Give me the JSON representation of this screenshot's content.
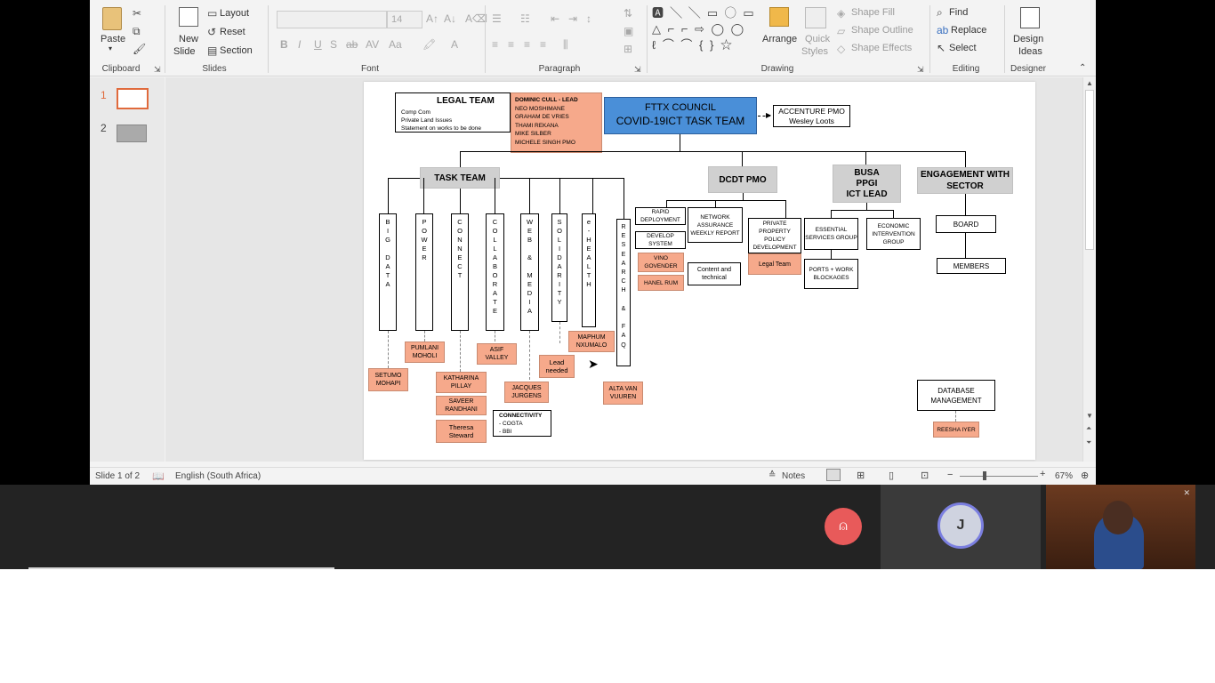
{
  "ribbon": {
    "clipboard": {
      "paste": "Paste",
      "label": "Clipboard"
    },
    "slides": {
      "new_slide": "New",
      "new_slide2": "Slide",
      "layout": "Layout",
      "reset": "Reset",
      "section": "Section",
      "label": "Slides"
    },
    "font": {
      "size": "14",
      "label": "Font"
    },
    "paragraph": {
      "label": "Paragraph"
    },
    "drawing": {
      "arrange": "Arrange",
      "quick_styles": "Quick",
      "quick_styles2": "Styles",
      "shape_fill": "Shape Fill",
      "shape_outline": "Shape Outline",
      "shape_effects": "Shape Effects",
      "label": "Drawing"
    },
    "editing": {
      "find": "Find",
      "replace": "Replace",
      "select": "Select",
      "label": "Editing"
    },
    "designer": {
      "design": "Design",
      "ideas": "Ideas",
      "label": "Designer"
    }
  },
  "thumbnails": [
    {
      "num": "1"
    },
    {
      "num": "2"
    }
  ],
  "slide": {
    "legal": {
      "title": "LEGAL TEAM",
      "items": [
        "Comp Com",
        "Private Land Issues",
        "Statement on works to be done"
      ]
    },
    "legal_members": [
      "DOMINIC CULL - LEAD",
      "NEO MOSHIMANE",
      "GRAHAM DE VRIES",
      "THAMI REKANA",
      "MIKE SILBER",
      "MICHELE SINGH PMO"
    ],
    "council": {
      "line1": "FTTX COUNCIL",
      "line2": "COVID-19ICT TASK TEAM"
    },
    "accenture": {
      "line1": "ACCENTURE PMO",
      "line2": "Wesley Loots"
    },
    "task_team": "TASK TEAM",
    "dcdt": "DCDT PMO",
    "busa": {
      "l1": "BUSA",
      "l2": "PPGI",
      "l3": "ICT LEAD"
    },
    "engagement": {
      "l1": "ENGAGEMENT WITH",
      "l2": "SECTOR"
    },
    "columns": [
      {
        "text": "B\nI\nG\n\nD\nA\nT\nA"
      },
      {
        "text": "P\nO\nW\nE\nR"
      },
      {
        "text": "C\nO\nN\nN\nE\nC\nT"
      },
      {
        "text": "C\nO\nL\nL\nA\nB\nO\nR\nA\nT\nE"
      },
      {
        "text": "W\nE\nB\n\n&\n\nM\nE\nD\nI\nA"
      },
      {
        "text": "S\nO\nL\nI\nD\nA\nR\nI\nT\nY"
      },
      {
        "text": "e\n-\nH\nE\nA\nL\nT\nH"
      },
      {
        "text": "R\nE\nS\nE\nA\nR\nC\nH\n\n&\n\nF\nA\nQ"
      }
    ],
    "people": {
      "setumo": "SETUMO MOHAPI",
      "pumlani": "PUMLANI MOHOLI",
      "katharina": "KATHARINA PILLAY",
      "saveer": "SAVEER RANDHANI",
      "theresa": "Theresa Steward",
      "asif": "ASIF VALLEY",
      "jacques": "JACQUES JURGENS",
      "lead_needed": "Lead needed",
      "maphum": "MAPHUM NXUMALO",
      "alta": "ALTA VAN VUUREN",
      "vino": "VINO GOVENDER",
      "hanel": "HANEL RUM",
      "legal_team2": "Legal Team",
      "reesha": "REESHA IYER"
    },
    "connectivity": {
      "title": "CONNECTIVITY",
      "items": [
        "- COGTA",
        "-  BBI"
      ]
    },
    "dcdt_items": {
      "rapid": "RAPID DEPLOYMENT",
      "develop": "DEVELOP SYSTEM",
      "network": "NETWORK ASSURANCE WEEKLY REPORT",
      "content": "Content and technical",
      "private": "PRIVATE PROPERTY POLICY DEVELOPMENT"
    },
    "busa_items": {
      "essential": "ESSENTIAL SERVICES GROUP",
      "economic": "ECONOMIC INTERVENTION GROUP",
      "ports": "PORTS + WORK BLOCKAGES"
    },
    "engagement_items": {
      "board": "BOARD",
      "members": "MEMBERS"
    },
    "database": "DATABASE MANAGEMENT"
  },
  "status": {
    "slide": "Slide 1 of 2",
    "language": "English (South Africa)",
    "notes": "Notes",
    "zoom": "67%"
  },
  "meeting": {
    "avatar_letter": "J",
    "accent": "#e85a5a",
    "avatar_ring": "#7b7fe0"
  }
}
